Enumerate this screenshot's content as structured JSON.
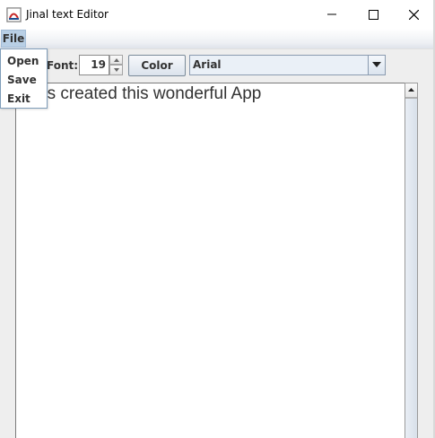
{
  "window": {
    "title": "Jinal text Editor"
  },
  "menubar": {
    "file_label": "File"
  },
  "file_menu": {
    "items": [
      {
        "label": "Open"
      },
      {
        "label": "Save"
      },
      {
        "label": "Exit"
      }
    ]
  },
  "toolbar": {
    "font_label": "Font:",
    "font_size_value": "19",
    "color_button_label": "Color",
    "font_family_value": "Arial"
  },
  "editor": {
    "text": "l has created this wonderful App"
  }
}
